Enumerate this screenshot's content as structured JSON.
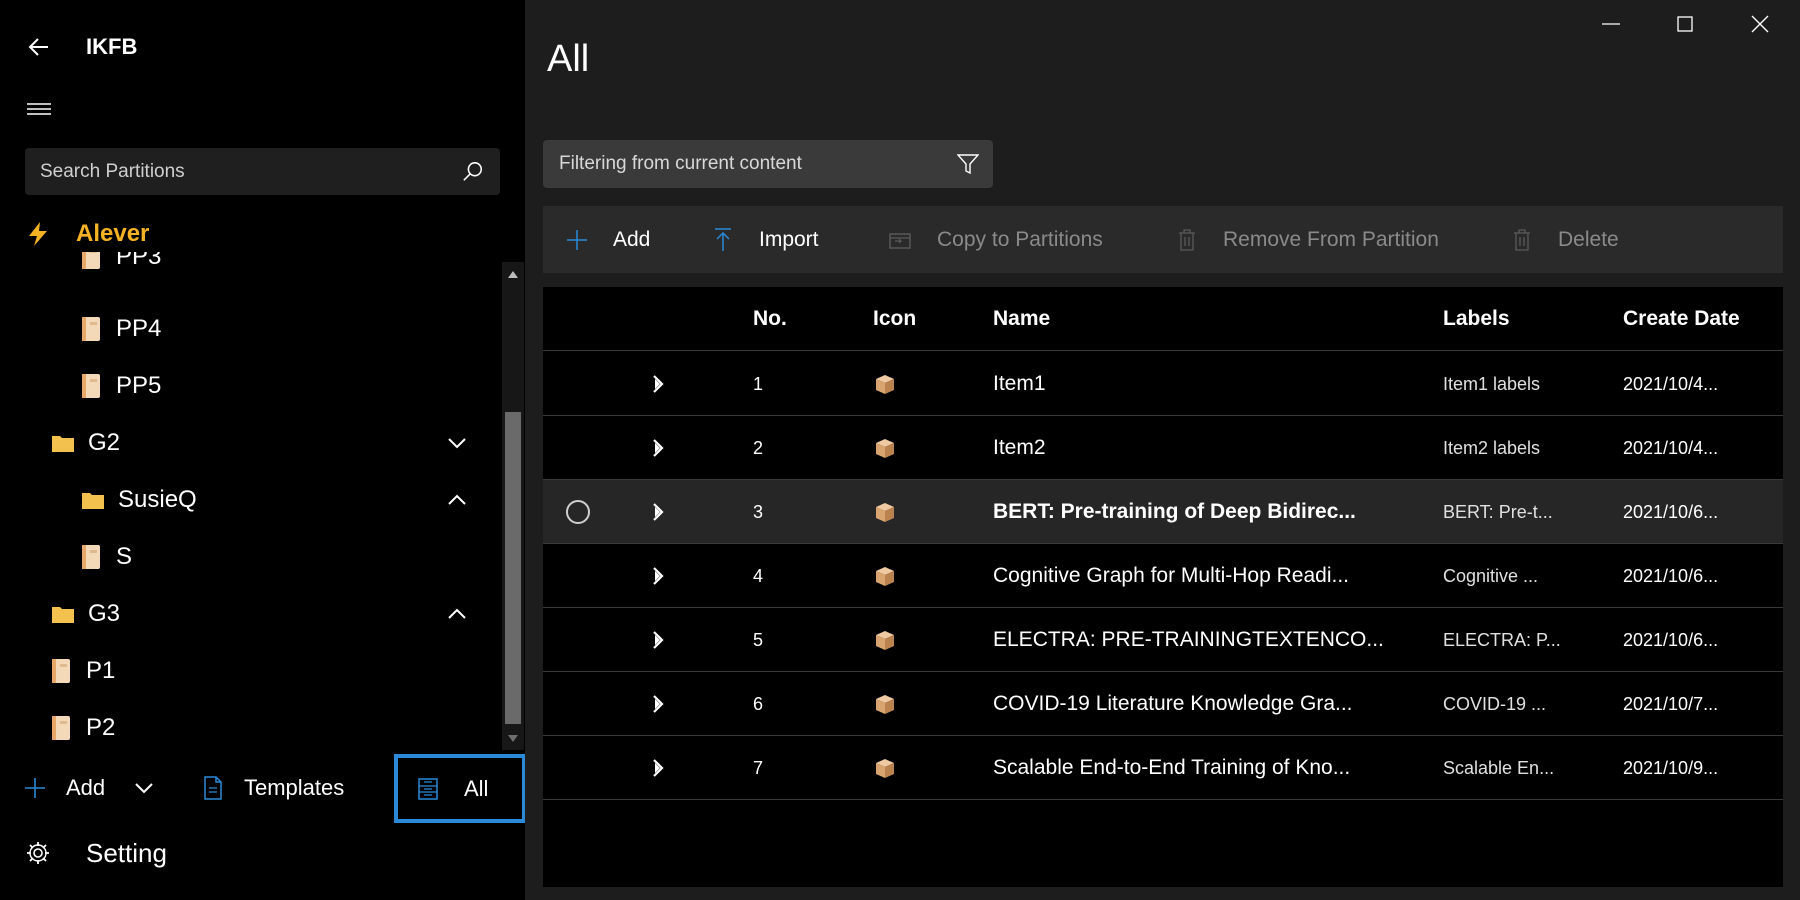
{
  "app": {
    "title": "IKFB"
  },
  "search": {
    "placeholder": "Search Partitions"
  },
  "tree": {
    "root_label": "Alever",
    "items": [
      {
        "label": "PP3"
      },
      {
        "label": "PP4"
      },
      {
        "label": "PP5"
      },
      {
        "label": "G2"
      },
      {
        "label": "SusieQ"
      },
      {
        "label": "S"
      },
      {
        "label": "G3"
      },
      {
        "label": "P1"
      },
      {
        "label": "P2"
      }
    ]
  },
  "bottom": {
    "add_label": "Add",
    "templates_label": "Templates",
    "all_label": "All",
    "setting_label": "Setting"
  },
  "main": {
    "title": "All",
    "filter_placeholder": "Filtering from current content",
    "toolbar": {
      "add": "Add",
      "import": "Import",
      "copy": "Copy to Partitions",
      "remove": "Remove From Partition",
      "delete": "Delete"
    },
    "columns": {
      "no": "No.",
      "icon": "Icon",
      "name": "Name",
      "labels": "Labels",
      "date": "Create Date"
    },
    "rows": [
      {
        "no": "1",
        "name": "Item1",
        "labels": "Item1 labels",
        "date": "2021/10/4..."
      },
      {
        "no": "2",
        "name": "Item2",
        "labels": "Item2 labels",
        "date": "2021/10/4..."
      },
      {
        "no": "3",
        "name": "BERT: Pre-training of Deep Bidirec...",
        "labels": "BERT: Pre-t...",
        "date": "2021/10/6..."
      },
      {
        "no": "4",
        "name": "Cognitive Graph for Multi-Hop Readi...",
        "labels": "Cognitive ...",
        "date": "2021/10/6..."
      },
      {
        "no": "5",
        "name": "ELECTRA: PRE-TRAININGTEXTENCO...",
        "labels": "ELECTRA: P...",
        "date": "2021/10/6..."
      },
      {
        "no": "6",
        "name": "COVID-19 Literature Knowledge Gra...",
        "labels": "COVID-19 ...",
        "date": "2021/10/7..."
      },
      {
        "no": "7",
        "name": "Scalable End-to-End Training of Kno...",
        "labels": "Scalable En...",
        "date": "2021/10/9..."
      }
    ]
  },
  "colors": {
    "accent": "#2a8ad8",
    "root_label": "#f5b324",
    "folder": "#f2c14e",
    "doc": "#f4d9b8"
  }
}
